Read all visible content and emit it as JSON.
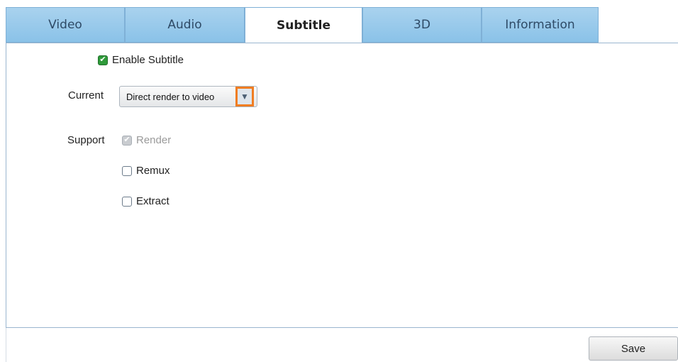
{
  "tabs": [
    {
      "label": "Video"
    },
    {
      "label": "Audio"
    },
    {
      "label": "Subtitle"
    },
    {
      "label": "3D"
    },
    {
      "label": "Information"
    }
  ],
  "active_tab": "Subtitle",
  "subtitle": {
    "enable_label": "Enable Subtitle",
    "enable_checked": true,
    "current_label": "Current",
    "current_value": "Direct render to video",
    "support_label": "Support",
    "support_options": [
      {
        "label": "Render",
        "checked": true,
        "disabled": true
      },
      {
        "label": "Remux",
        "checked": false,
        "disabled": false
      },
      {
        "label": "Extract",
        "checked": false,
        "disabled": false
      }
    ]
  },
  "footer": {
    "save_label": "Save"
  },
  "colors": {
    "tab_bg": "#9ccbeb",
    "highlight": "#f07d22",
    "checked": "#2f9a3a"
  }
}
